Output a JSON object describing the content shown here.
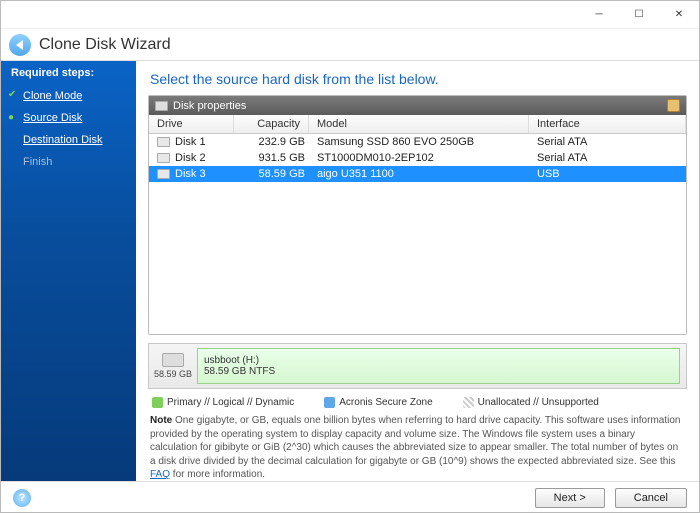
{
  "window": {
    "title": "Clone Disk Wizard"
  },
  "sidebar": {
    "section": "Required steps:",
    "steps": [
      {
        "label": "Clone Mode",
        "state": "done"
      },
      {
        "label": "Source Disk",
        "state": "current"
      },
      {
        "label": "Destination Disk",
        "state": "pending"
      },
      {
        "label": "Finish",
        "state": "disabled"
      }
    ]
  },
  "main": {
    "title": "Select the source hard disk from the list below.",
    "panel_title": "Disk properties",
    "columns": {
      "drive": "Drive",
      "capacity": "Capacity",
      "model": "Model",
      "interface": "Interface"
    },
    "disks": [
      {
        "drive": "Disk 1",
        "capacity": "232.9 GB",
        "model": "Samsung SSD 860 EVO 250GB",
        "interface": "Serial ATA",
        "selected": false
      },
      {
        "drive": "Disk 2",
        "capacity": "931.5 GB",
        "model": "ST1000DM010-2EP102",
        "interface": "Serial ATA",
        "selected": false
      },
      {
        "drive": "Disk 3",
        "capacity": "58.59 GB",
        "model": "aigo U351 1100",
        "interface": "USB",
        "selected": true
      }
    ],
    "partition": {
      "disk_size": "58.59 GB",
      "volume_label": "usbboot (H:)",
      "volume_detail": "58.59 GB  NTFS"
    },
    "legend": {
      "primary": "Primary // Logical // Dynamic",
      "zone": "Acronis Secure Zone",
      "unalloc": "Unallocated // Unsupported"
    },
    "note_label": "Note",
    "note_body": "One gigabyte, or GB, equals one billion bytes when referring to hard drive capacity. This software uses information provided by the operating system to display capacity and volume size. The Windows file system uses a binary calculation for gibibyte or GiB (2^30) which causes the abbreviated size to appear smaller. The total number of bytes on a disk drive divided by the decimal calculation for gigabyte or GB (10^9) shows the expected abbreviated size. See this ",
    "note_link": "FAQ",
    "note_tail": " for more information."
  },
  "footer": {
    "next": "Next >",
    "cancel": "Cancel"
  },
  "colors": {
    "accent": "#1a66c0",
    "selection": "#1e90ff",
    "partition": "#9bd08f"
  }
}
